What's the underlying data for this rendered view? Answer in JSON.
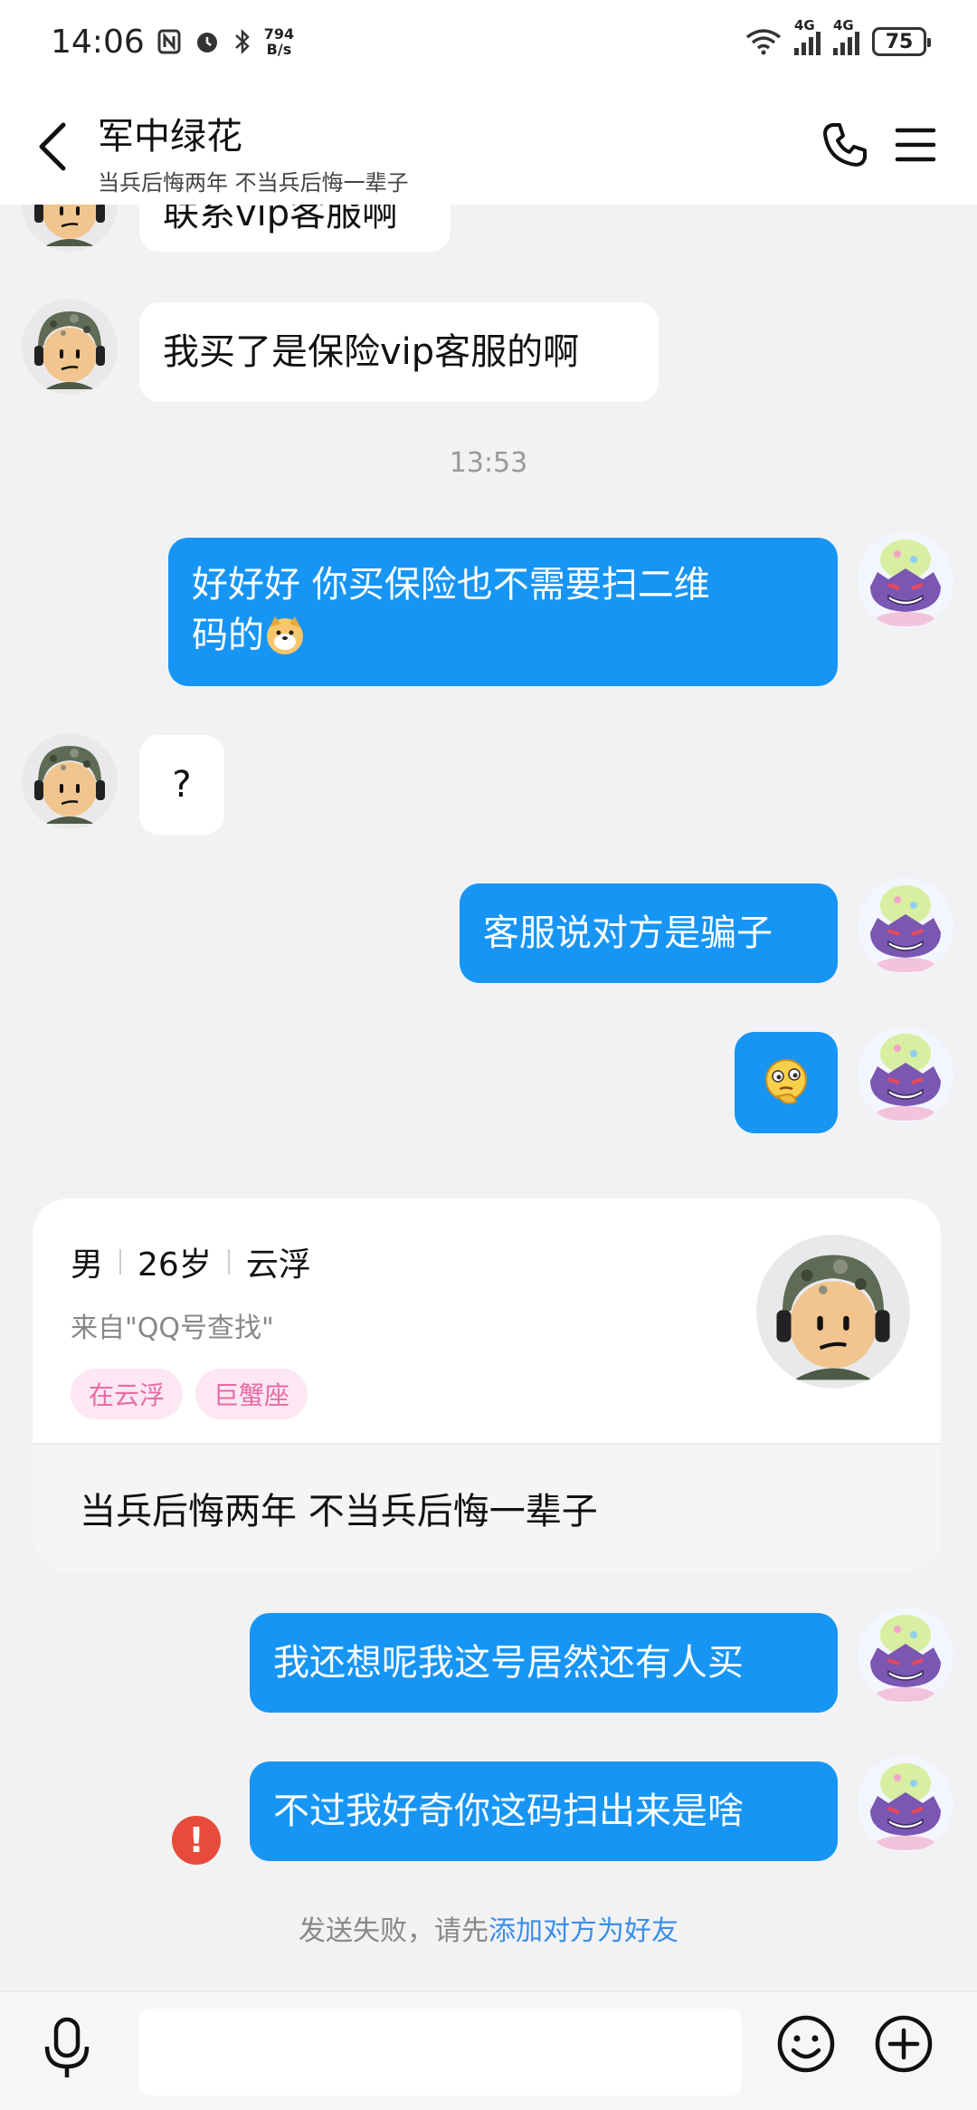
{
  "status_bar": {
    "time": "14:06",
    "net_speed_value": "794",
    "net_speed_unit": "B/s",
    "signal1_label": "4G",
    "signal2_label": "4G",
    "battery": "75",
    "icons": [
      "nfc-icon",
      "alarm-icon",
      "bluetooth-icon",
      "wifi-icon"
    ]
  },
  "header": {
    "title": "军中绿花",
    "subtitle": "当兵后悔两年 不当兵后悔一辈子"
  },
  "messages": {
    "m0_text": "联系vip客服啊",
    "m1_text": "我买了是保险vip客服的啊",
    "time_sep": "13:53",
    "m2_line1": "好好好 你买保险也不需要扫二维",
    "m2_line2": "码的",
    "m3_text": "?",
    "m4_text": "客服说对方是骗子",
    "m6_text": "我还想呢我这号居然还有人买",
    "m7_text": "不过我好奇你这码扫出来是啥",
    "fail_icon": "!",
    "fail_note_prefix": "发送失败，请先",
    "fail_note_link": "添加对方为好友"
  },
  "profile_card": {
    "gender": "男",
    "age": "26岁",
    "location": "云浮",
    "source": "来自\"QQ号查找\"",
    "tags": [
      "在云浮",
      "巨蟹座"
    ],
    "signature": "当兵后悔两年 不当兵后悔一辈子"
  },
  "input": {
    "placeholder": ""
  },
  "colors": {
    "outgoing_bubble": "#1695f5",
    "incoming_bubble": "#ffffff",
    "background": "#f2f2f4",
    "link": "#3a8ee8",
    "fail": "#e84a3c",
    "tag_bg": "#fde7f3",
    "tag_text": "#e86aa7"
  }
}
